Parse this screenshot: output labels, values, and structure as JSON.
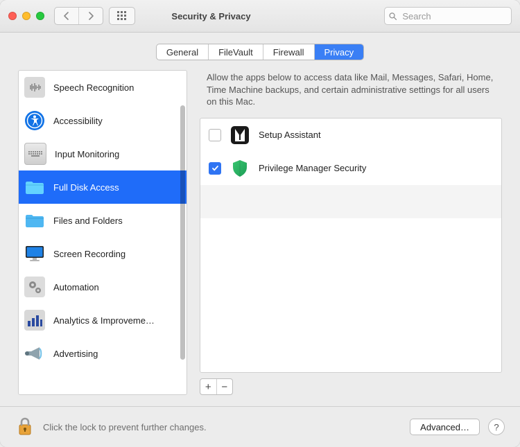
{
  "header": {
    "title": "Security & Privacy",
    "search_placeholder": "Search"
  },
  "tabs": [
    {
      "id": "general",
      "label": "General",
      "active": false
    },
    {
      "id": "filevault",
      "label": "FileVault",
      "active": false
    },
    {
      "id": "firewall",
      "label": "Firewall",
      "active": false
    },
    {
      "id": "privacy",
      "label": "Privacy",
      "active": true
    }
  ],
  "sidebar": {
    "items": [
      {
        "id": "speech",
        "label": "Speech Recognition",
        "icon": "waveform",
        "selected": false
      },
      {
        "id": "accessibility",
        "label": "Accessibility",
        "icon": "accessibility",
        "selected": false
      },
      {
        "id": "input-monitoring",
        "label": "Input Monitoring",
        "icon": "keyboard",
        "selected": false
      },
      {
        "id": "full-disk",
        "label": "Full Disk Access",
        "icon": "folder",
        "selected": true
      },
      {
        "id": "files-folders",
        "label": "Files and Folders",
        "icon": "folder",
        "selected": false
      },
      {
        "id": "screen-rec",
        "label": "Screen Recording",
        "icon": "display",
        "selected": false
      },
      {
        "id": "automation",
        "label": "Automation",
        "icon": "gears",
        "selected": false
      },
      {
        "id": "analytics",
        "label": "Analytics & Improveme…",
        "icon": "bar-chart",
        "selected": false
      },
      {
        "id": "advertising",
        "label": "Advertising",
        "icon": "megaphone",
        "selected": false
      }
    ]
  },
  "main": {
    "description": "Allow the apps below to access data like Mail, Messages, Safari, Home, Time Machine backups, and certain administrative settings for all users on this Mac.",
    "apps": [
      {
        "id": "setup-assistant",
        "label": "Setup Assistant",
        "checked": false,
        "icon": "tuxedo"
      },
      {
        "id": "privilege-manager",
        "label": "Privilege Manager Security",
        "checked": true,
        "icon": "shield"
      }
    ],
    "add_label": "+",
    "remove_label": "−"
  },
  "footer": {
    "lock_text": "Click the lock to prevent further changes.",
    "advanced_label": "Advanced…",
    "help_label": "?"
  }
}
